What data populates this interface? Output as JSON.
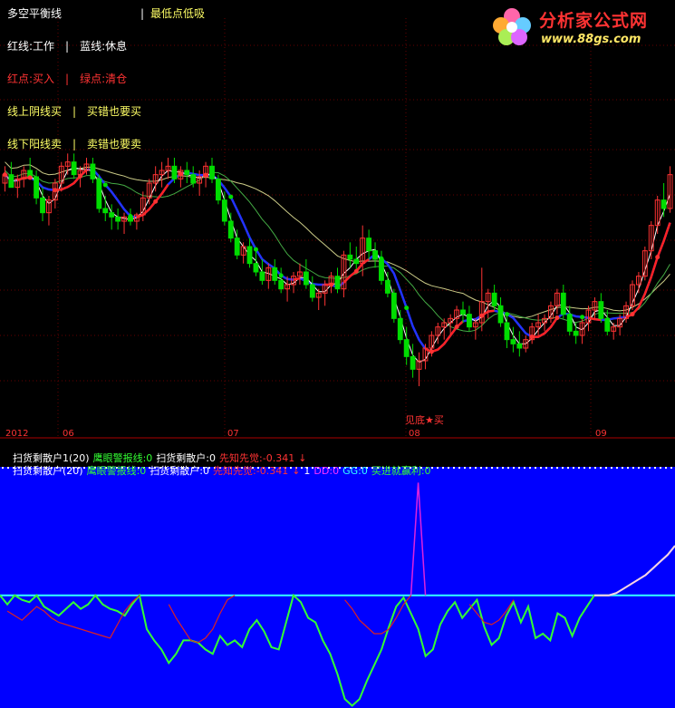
{
  "header": {
    "line1_title": "多空平衡线",
    "line1_sep": "|",
    "line1_right": "最低点低吸",
    "line2": "红线:工作　|　蓝线:休息",
    "line3": "红点:买入　|　绿点:清仓",
    "line4": "线上阴线买　|　买错也要买",
    "line5": "线下阳线卖　|　卖错也要卖"
  },
  "logo": {
    "brand": "分析家公式网",
    "url": "www.88gs.com",
    "icon": "flower-logo-icon"
  },
  "xaxis_labels": [
    "2012",
    "06",
    "07",
    "08",
    "09"
  ],
  "buy_label": "见底★买",
  "status_line1": {
    "name": "扫货剩散户1(20)",
    "a": "鹰眼警报线:0",
    "b": "扫货剩散户:0",
    "c": "先知先觉:-0.341",
    "arrow": "↓"
  },
  "status_line2": {
    "name": "扫货剩散户(20)",
    "a": "鹰眼警报线:0",
    "b": "扫货剩散户:0",
    "c": "先知先觉:-0.341",
    "arrow": "↓",
    "d": "1",
    "e": "DD:0",
    "f": "GG:0",
    "g": "买进就赢利:0"
  },
  "colors": {
    "up": "#ff3333",
    "down": "#00dd00",
    "blue_line": "#2233ff",
    "red_line": "#ff2222",
    "panel_bg": "#0000ff",
    "zero_line": "#33ffff",
    "indicator_green": "#33ff33",
    "indicator_red": "#dd2222",
    "indicator_magenta": "#dd22dd"
  },
  "chart_data": {
    "type": "candlestick",
    "x_type": "daily sessions, late May to Sep 2012",
    "price_ylim": [
      0,
      100
    ],
    "candles": [
      [
        62,
        70,
        58,
        66
      ],
      [
        66,
        72,
        62,
        60
      ],
      [
        60,
        66,
        55,
        64
      ],
      [
        64,
        70,
        60,
        68
      ],
      [
        68,
        74,
        64,
        65
      ],
      [
        65,
        68,
        52,
        55
      ],
      [
        55,
        60,
        44,
        48
      ],
      [
        48,
        56,
        42,
        54
      ],
      [
        54,
        64,
        50,
        62
      ],
      [
        62,
        72,
        58,
        70
      ],
      [
        70,
        76,
        66,
        72
      ],
      [
        72,
        76,
        64,
        66
      ],
      [
        66,
        70,
        60,
        68
      ],
      [
        68,
        74,
        66,
        71
      ],
      [
        71,
        74,
        62,
        64
      ],
      [
        64,
        66,
        48,
        50
      ],
      [
        50,
        56,
        44,
        48
      ],
      [
        48,
        52,
        40,
        46
      ],
      [
        46,
        50,
        40,
        44
      ],
      [
        44,
        48,
        38,
        46
      ],
      [
        46,
        50,
        42,
        44
      ],
      [
        44,
        48,
        40,
        47
      ],
      [
        47,
        58,
        44,
        55
      ],
      [
        55,
        64,
        52,
        62
      ],
      [
        62,
        70,
        58,
        66
      ],
      [
        66,
        72,
        60,
        68
      ],
      [
        68,
        74,
        64,
        70
      ],
      [
        70,
        74,
        62,
        64
      ],
      [
        64,
        70,
        60,
        68
      ],
      [
        68,
        72,
        62,
        66
      ],
      [
        66,
        70,
        60,
        62
      ],
      [
        62,
        68,
        56,
        65
      ],
      [
        65,
        72,
        60,
        70
      ],
      [
        70,
        74,
        62,
        64
      ],
      [
        64,
        66,
        52,
        54
      ],
      [
        54,
        58,
        42,
        44
      ],
      [
        44,
        48,
        34,
        36
      ],
      [
        36,
        40,
        26,
        28
      ],
      [
        28,
        34,
        24,
        32
      ],
      [
        32,
        36,
        22,
        24
      ],
      [
        24,
        30,
        18,
        20
      ],
      [
        20,
        26,
        14,
        16
      ],
      [
        16,
        24,
        12,
        22
      ],
      [
        22,
        26,
        14,
        16
      ],
      [
        16,
        22,
        10,
        12
      ],
      [
        12,
        18,
        6,
        14
      ],
      [
        14,
        20,
        10,
        18
      ],
      [
        18,
        24,
        14,
        20
      ],
      [
        20,
        26,
        12,
        14
      ],
      [
        14,
        18,
        6,
        8
      ],
      [
        8,
        12,
        2,
        10
      ],
      [
        10,
        16,
        4,
        14
      ],
      [
        14,
        20,
        10,
        18
      ],
      [
        18,
        22,
        10,
        12
      ],
      [
        12,
        30,
        8,
        28
      ],
      [
        28,
        34,
        22,
        26
      ],
      [
        26,
        32,
        20,
        24
      ],
      [
        24,
        42,
        18,
        36
      ],
      [
        36,
        40,
        26,
        30
      ],
      [
        30,
        34,
        22,
        26
      ],
      [
        26,
        30,
        14,
        16
      ],
      [
        16,
        20,
        8,
        10
      ],
      [
        10,
        12,
        -4,
        -2
      ],
      [
        -2,
        2,
        -14,
        -12
      ],
      [
        -12,
        -6,
        -24,
        -20
      ],
      [
        -20,
        -14,
        -30,
        -26
      ],
      [
        -26,
        -18,
        -34,
        -22
      ],
      [
        -22,
        -14,
        -26,
        -16
      ],
      [
        -16,
        -8,
        -20,
        -10
      ],
      [
        -10,
        -4,
        -14,
        -6
      ],
      [
        -6,
        -2,
        -12,
        -4
      ],
      [
        -4,
        0,
        -10,
        -2
      ],
      [
        -2,
        4,
        -6,
        2
      ],
      [
        2,
        6,
        -4,
        0
      ],
      [
        0,
        4,
        -8,
        -6
      ],
      [
        -6,
        -2,
        -12,
        -4
      ],
      [
        -4,
        22,
        -8,
        6
      ],
      [
        6,
        12,
        -2,
        10
      ],
      [
        10,
        14,
        2,
        4
      ],
      [
        4,
        8,
        -6,
        -4
      ],
      [
        -4,
        0,
        -16,
        -12
      ],
      [
        -12,
        -6,
        -18,
        -14
      ],
      [
        -14,
        -8,
        -20,
        -16
      ],
      [
        -16,
        -10,
        -18,
        -12
      ],
      [
        -12,
        -4,
        -14,
        -6
      ],
      [
        -6,
        0,
        -10,
        -4
      ],
      [
        -4,
        0,
        -8,
        -2
      ],
      [
        -2,
        6,
        -4,
        4
      ],
      [
        4,
        12,
        0,
        10
      ],
      [
        10,
        14,
        -2,
        0
      ],
      [
        0,
        4,
        -10,
        -8
      ],
      [
        -8,
        -4,
        -14,
        -10
      ],
      [
        -10,
        -2,
        -14,
        -4
      ],
      [
        -4,
        4,
        -8,
        2
      ],
      [
        2,
        8,
        -2,
        6
      ],
      [
        6,
        10,
        -4,
        -2
      ],
      [
        -2,
        2,
        -10,
        -8
      ],
      [
        -8,
        -4,
        -12,
        -6
      ],
      [
        -6,
        0,
        -10,
        -2
      ],
      [
        -2,
        6,
        -4,
        4
      ],
      [
        4,
        16,
        2,
        14
      ],
      [
        14,
        20,
        10,
        18
      ],
      [
        18,
        32,
        16,
        30
      ],
      [
        30,
        44,
        26,
        42
      ],
      [
        42,
        56,
        38,
        54
      ],
      [
        54,
        62,
        46,
        50
      ],
      [
        50,
        70,
        48,
        66
      ]
    ],
    "indicator_ylim": [
      -100,
      110
    ],
    "indicator_green": [
      0,
      -8,
      0,
      -4,
      -6,
      0,
      -10,
      -14,
      -18,
      -12,
      -6,
      -12,
      -8,
      0,
      -8,
      -12,
      -14,
      -18,
      -8,
      0,
      -30,
      -40,
      -48,
      -60,
      -52,
      -40,
      -40,
      -42,
      -48,
      -52,
      -36,
      -44,
      -40,
      -46,
      -30,
      -22,
      -32,
      -46,
      -48,
      -24,
      0,
      -6,
      -20,
      -24,
      -40,
      -52,
      -70,
      -92,
      -98,
      -92,
      -76,
      -62,
      -48,
      -28,
      -10,
      -2,
      -16,
      -30,
      -54,
      -48,
      -26,
      -14,
      -6,
      -20,
      -12,
      -4,
      -28,
      -44,
      -38,
      -18,
      -6,
      -24,
      -10,
      -38,
      -34,
      -40,
      -16,
      -20,
      -36,
      -20,
      -10,
      0,
      0,
      0,
      2,
      6,
      10,
      14,
      18,
      24,
      30,
      36,
      44
    ],
    "indicator_red": [
      null,
      -14,
      -18,
      -22,
      -16,
      -10,
      -14,
      -20,
      -24,
      -26,
      -28,
      -30,
      -32,
      -34,
      -36,
      -38,
      -26,
      -14,
      -6,
      0,
      null,
      null,
      null,
      -8,
      -20,
      -30,
      -40,
      -42,
      -38,
      -30,
      -16,
      -4,
      0,
      null,
      null,
      null,
      null,
      null,
      null,
      null,
      null,
      null,
      null,
      null,
      null,
      null,
      null,
      -4,
      -12,
      -22,
      -28,
      -34,
      -34,
      -30,
      -20,
      -8,
      0,
      null,
      null,
      null,
      null,
      null,
      null,
      null,
      -8,
      -16,
      -24,
      -26,
      -22,
      -14,
      -4,
      null,
      null,
      null,
      null,
      null,
      null,
      null,
      null,
      null,
      null,
      null,
      null,
      null,
      null,
      null,
      null,
      null,
      null,
      null,
      null,
      null
    ],
    "indicator_magenta_spike": {
      "x_index": 57,
      "value": 100
    },
    "zero_line": 0
  }
}
